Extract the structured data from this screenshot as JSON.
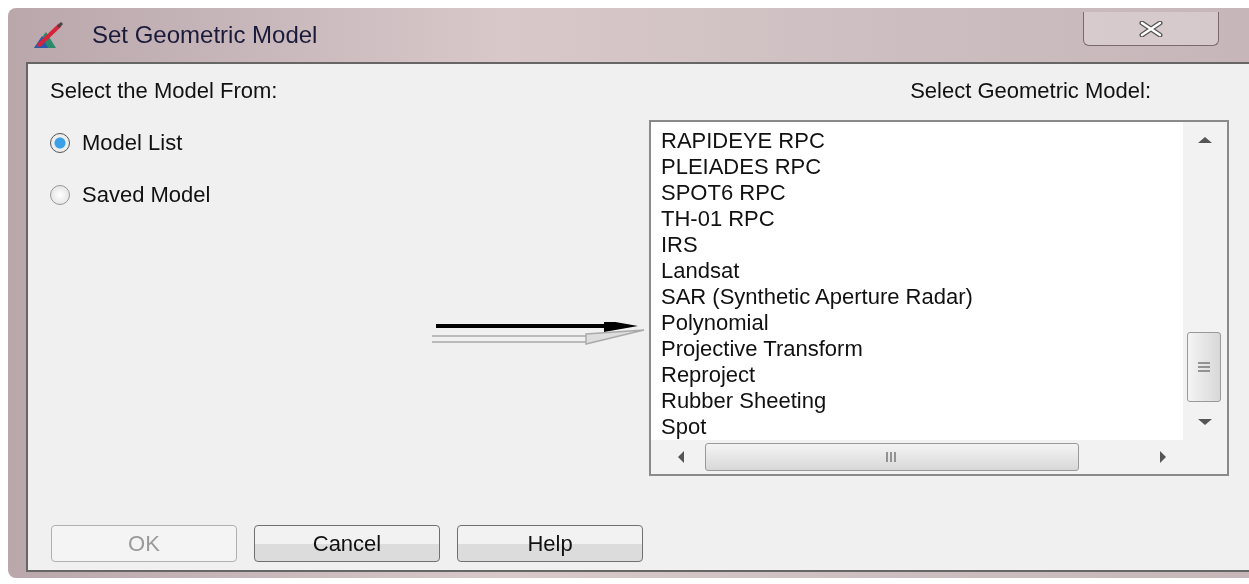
{
  "window": {
    "title": "Set Geometric Model"
  },
  "left_label": "Select the Model From:",
  "sources": [
    {
      "label": "Model List",
      "selected": true
    },
    {
      "label": "Saved Model",
      "selected": false
    }
  ],
  "right_label": "Select Geometric Model:",
  "models": [
    "RAPIDEYE RPC",
    "PLEIADES RPC",
    "SPOT6 RPC",
    "TH-01 RPC",
    "IRS",
    "Landsat",
    "SAR (Synthetic Aperture Radar)",
    "Polynomial",
    "Projective Transform",
    "Reproject",
    "Rubber Sheeting",
    "Spot"
  ],
  "buttons": [
    {
      "label": "OK",
      "disabled": true
    },
    {
      "label": "Cancel",
      "disabled": false
    },
    {
      "label": "Help",
      "disabled": false
    }
  ]
}
